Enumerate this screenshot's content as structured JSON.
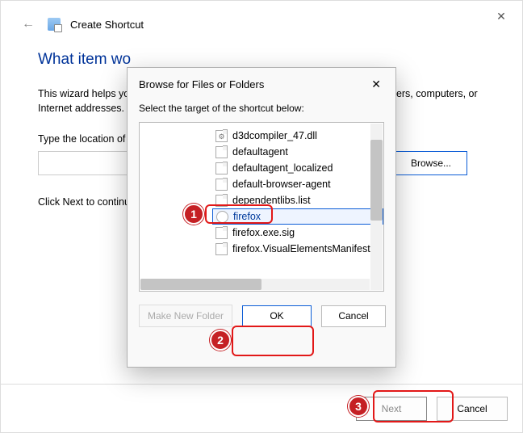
{
  "wizard": {
    "window_title": "Create Shortcut",
    "heading": "What item wo",
    "description": "This wizard helps you to create shortcuts to local or network programs, files, folders, computers, or Internet addresses.",
    "location_label": "Type the location of the item:",
    "location_value": "",
    "browse_label": "Browse...",
    "continue_label": "Click Next to continue.",
    "next_label": "Next",
    "cancel_label": "Cancel"
  },
  "dialog": {
    "title": "Browse for Files or Folders",
    "instruction": "Select the target of the shortcut below:",
    "items": [
      {
        "icon": "gear",
        "label": "d3dcompiler_47.dll"
      },
      {
        "icon": "file",
        "label": "defaultagent"
      },
      {
        "icon": "file",
        "label": "defaultagent_localized"
      },
      {
        "icon": "exe",
        "label": "default-browser-agent"
      },
      {
        "icon": "file",
        "label": "dependentlibs.list"
      },
      {
        "icon": "firefox",
        "label": "firefox",
        "selected": true
      },
      {
        "icon": "file",
        "label": "firefox.exe.sig"
      },
      {
        "icon": "file",
        "label": "firefox.VisualElementsManifest"
      }
    ],
    "make_folder_label": "Make New Folder",
    "ok_label": "OK",
    "cancel_label": "Cancel"
  },
  "annotations": {
    "one": "1",
    "two": "2",
    "three": "3"
  }
}
